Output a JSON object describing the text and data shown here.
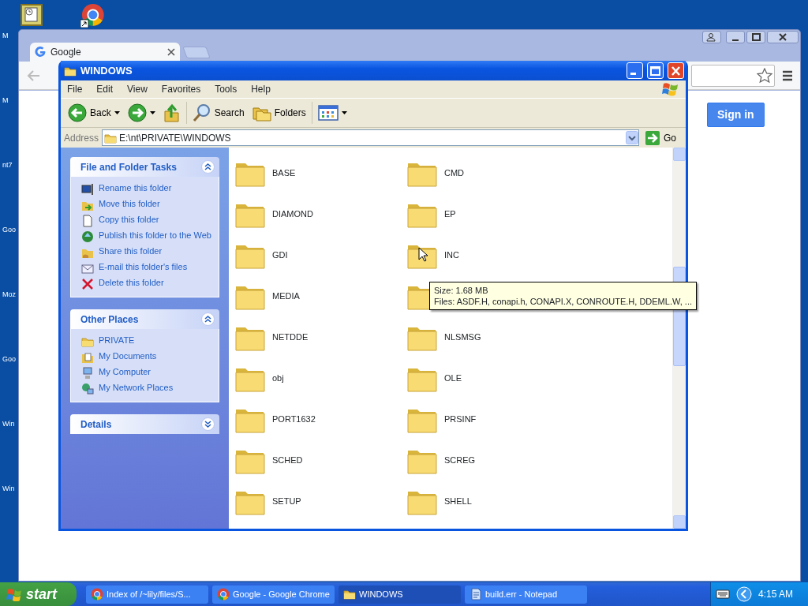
{
  "desktop": {
    "icons": [
      {
        "label": "M"
      },
      {
        "label": "M"
      },
      {
        "label": "nt7"
      },
      {
        "label": "Goo"
      },
      {
        "label": "Moz"
      },
      {
        "label": "Goo"
      },
      {
        "label": "Win"
      },
      {
        "label": "Win"
      }
    ]
  },
  "browser": {
    "tab": {
      "title": "Google"
    },
    "sign_in": "Sign in"
  },
  "explorer": {
    "title": "WINDOWS",
    "menu": [
      "File",
      "Edit",
      "View",
      "Favorites",
      "Tools",
      "Help"
    ],
    "toolbar": {
      "back": "Back",
      "search": "Search",
      "folders": "Folders"
    },
    "address": {
      "label": "Address",
      "value": "E:\\nt\\PRIVATE\\WINDOWS",
      "go": "Go"
    },
    "panels": [
      {
        "title": "File and Folder Tasks",
        "expanded": true,
        "items": [
          "Rename this folder",
          "Move this folder",
          "Copy this folder",
          "Publish this folder to the Web",
          "Share this folder",
          "E-mail this folder's files",
          "Delete this folder"
        ]
      },
      {
        "title": "Other Places",
        "expanded": true,
        "items": [
          "PRIVATE",
          "My Documents",
          "My Computer",
          "My Network Places"
        ]
      },
      {
        "title": "Details",
        "expanded": false
      }
    ],
    "folders": [
      {
        "kind": "folder",
        "label": "BASE"
      },
      {
        "kind": "folder",
        "label": "CMD"
      },
      {
        "kind": "folder",
        "label": "DIAMOND"
      },
      {
        "kind": "folder",
        "label": "EP"
      },
      {
        "kind": "folder",
        "label": "GDI"
      },
      {
        "kind": "folder",
        "label": "INC"
      },
      {
        "kind": "folder",
        "label": "MEDIA"
      },
      {
        "kind": "folder"
      },
      {
        "kind": "folder",
        "label": "NETDDE"
      },
      {
        "kind": "folder",
        "label": "NLSMSG"
      },
      {
        "kind": "folder",
        "label": "obj"
      },
      {
        "kind": "folder",
        "label": "OLE"
      },
      {
        "kind": "folder",
        "label": "PORT1632"
      },
      {
        "kind": "folder",
        "label": "PRSINF"
      },
      {
        "kind": "folder",
        "label": "SCHED"
      },
      {
        "kind": "folder",
        "label": "SCREG"
      },
      {
        "kind": "folder",
        "label": "SETUP"
      },
      {
        "kind": "folder",
        "label": "SHELL"
      }
    ],
    "tooltip": [
      "Size: 1.68 MB",
      "Files: ASDF.H, conapi.h, CONAPI.X, CONROUTE.H, DDEML.W, ..."
    ]
  },
  "taskbar": {
    "start": "start",
    "tasks": [
      {
        "label": "Index of /~lily/files/S...",
        "kind": "chrome",
        "selected": false
      },
      {
        "label": "Google - Google Chrome",
        "kind": "chrome",
        "selected": false
      },
      {
        "label": "WINDOWS",
        "kind": "folder",
        "selected": true
      },
      {
        "label": "build.err - Notepad",
        "kind": "notepad",
        "selected": false
      }
    ],
    "clock": "4:15 AM"
  }
}
